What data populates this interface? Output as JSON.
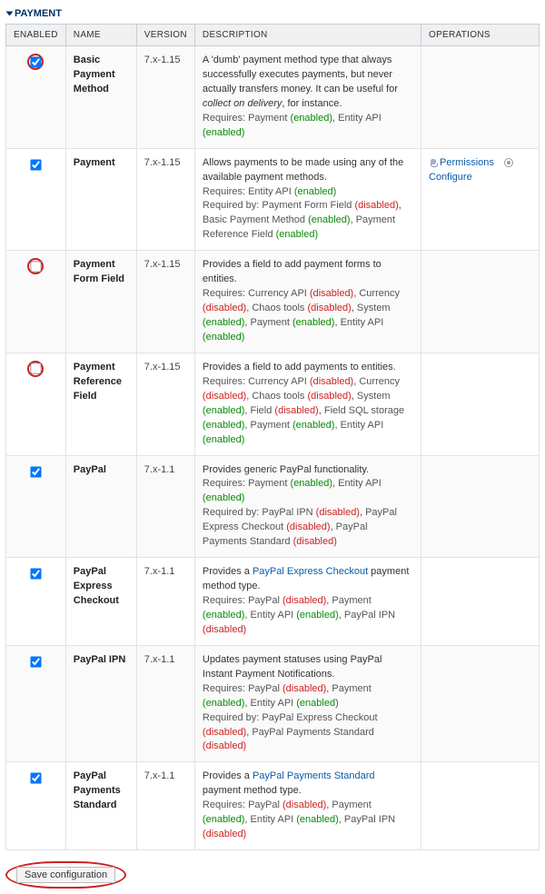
{
  "panel": {
    "title": "PAYMENT"
  },
  "headers": {
    "enabled": "ENABLED",
    "name": "NAME",
    "version": "VERSION",
    "description": "DESCRIPTION",
    "operations": "OPERATIONS"
  },
  "labels": {
    "requires": "Requires: ",
    "required_by": "Required by: "
  },
  "ops": {
    "permissions": "Permissions",
    "configure": "Configure"
  },
  "rows": {
    "r0": {
      "name": "Basic Payment Method",
      "version": "7.x-1.15",
      "desc": "A 'dumb' payment method type that always successfully executes payments, but never actually transfers money. It can be useful for ",
      "desc_em": "collect on delivery",
      "desc_tail": ", for instance.",
      "req": [
        {
          "t": "Payment ",
          "s": "enabled"
        },
        {
          "t": ", Entity API ",
          "s": "enabled"
        }
      ]
    },
    "r1": {
      "name": "Payment",
      "version": "7.x-1.15",
      "desc": "Allows payments to be made using any of the available payment methods.",
      "req": [
        {
          "t": "Entity API ",
          "s": "enabled"
        }
      ],
      "reqby": [
        {
          "t": "Payment Form Field ",
          "s": "disabled"
        },
        {
          "t": ", Basic Payment Method ",
          "s": "enabled"
        },
        {
          "t": ", Payment Reference Field ",
          "s": "enabled"
        }
      ]
    },
    "r2": {
      "name": "Payment Form Field",
      "version": "7.x-1.15",
      "desc": "Provides a field to add payment forms to entities.",
      "req": [
        {
          "t": "Currency API ",
          "s": "disabled"
        },
        {
          "t": ", Currency ",
          "s": "disabled"
        },
        {
          "t": ", Chaos tools ",
          "s": "disabled"
        },
        {
          "t": ", System ",
          "s": "enabled"
        },
        {
          "t": ", Payment ",
          "s": "enabled"
        },
        {
          "t": ", Entity API ",
          "s": "enabled"
        }
      ]
    },
    "r3": {
      "name": "Payment Reference Field",
      "version": "7.x-1.15",
      "desc": "Provides a field to add payments to entities.",
      "req": [
        {
          "t": "Currency API ",
          "s": "disabled"
        },
        {
          "t": ", Currency ",
          "s": "disabled"
        },
        {
          "t": ", Chaos tools ",
          "s": "disabled"
        },
        {
          "t": ", System ",
          "s": "enabled"
        },
        {
          "t": ", Field ",
          "s": "disabled"
        },
        {
          "t": ", Field SQL storage ",
          "s": "enabled"
        },
        {
          "t": ", Payment ",
          "s": "enabled"
        },
        {
          "t": ", Entity API ",
          "s": "enabled"
        }
      ]
    },
    "r4": {
      "name": "PayPal",
      "version": "7.x-1.1",
      "desc": "Provides generic PayPal functionality.",
      "req": [
        {
          "t": "Payment ",
          "s": "enabled"
        },
        {
          "t": ", Entity API ",
          "s": "enabled"
        }
      ],
      "reqby": [
        {
          "t": "PayPal IPN ",
          "s": "disabled"
        },
        {
          "t": ", PayPal Express Checkout ",
          "s": "disabled"
        },
        {
          "t": ", PayPal Payments Standard ",
          "s": "disabled"
        }
      ]
    },
    "r5": {
      "name": "PayPal Express Checkout",
      "version": "7.x-1.1",
      "desc_pre": "Provides a ",
      "desc_link": "PayPal Express Checkout",
      "desc_post": " payment method type.",
      "req": [
        {
          "t": "PayPal ",
          "s": "disabled"
        },
        {
          "t": ", Payment ",
          "s": "enabled"
        },
        {
          "t": ", Entity API ",
          "s": "enabled"
        },
        {
          "t": ", PayPal IPN ",
          "s": "disabled"
        }
      ]
    },
    "r6": {
      "name": "PayPal IPN",
      "version": "7.x-1.1",
      "desc": "Updates payment statuses using PayPal Instant Payment Notifications.",
      "req": [
        {
          "t": "PayPal ",
          "s": "disabled"
        },
        {
          "t": ", Payment ",
          "s": "enabled"
        },
        {
          "t": ", Entity API ",
          "s": "enabled"
        }
      ],
      "reqby": [
        {
          "t": "PayPal Express Checkout ",
          "s": "disabled"
        },
        {
          "t": ", PayPal Payments Standard ",
          "s": "disabled"
        }
      ]
    },
    "r7": {
      "name": "PayPal Payments Standard",
      "version": "7.x-1.1",
      "desc_pre": "Provides a ",
      "desc_link": "PayPal Payments Standard",
      "desc_post": " payment method type.",
      "req": [
        {
          "t": "PayPal ",
          "s": "disabled"
        },
        {
          "t": ", Payment ",
          "s": "enabled"
        },
        {
          "t": ", Entity API ",
          "s": "enabled"
        },
        {
          "t": ", PayPal IPN ",
          "s": "disabled"
        }
      ]
    }
  },
  "status_text": {
    "enabled": "enabled",
    "disabled": "disabled"
  },
  "save_button": "Save configuration"
}
